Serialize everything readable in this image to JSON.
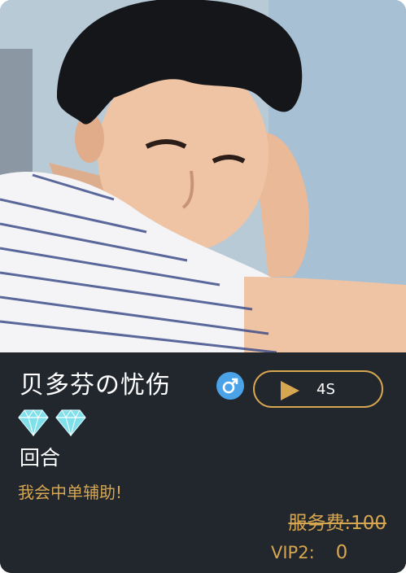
{
  "profile": {
    "name": "贝多芬の忧伤",
    "gender_icon": "male-symbol-icon",
    "level_icons": [
      "diamond-icon",
      "diamond-icon"
    ],
    "game": "回合",
    "motto": "我会中单辅助!"
  },
  "voice": {
    "play_icon": "play-icon",
    "duration": "4S"
  },
  "pricing": {
    "service_fee": "服务费:100",
    "vip_label": "VIP2:",
    "vip_price": "0"
  },
  "colors": {
    "accent": "#d6a651",
    "card_bg": "#22262d",
    "gender_blue": "#4aa3e8",
    "diamond": "#7fe0ea"
  }
}
